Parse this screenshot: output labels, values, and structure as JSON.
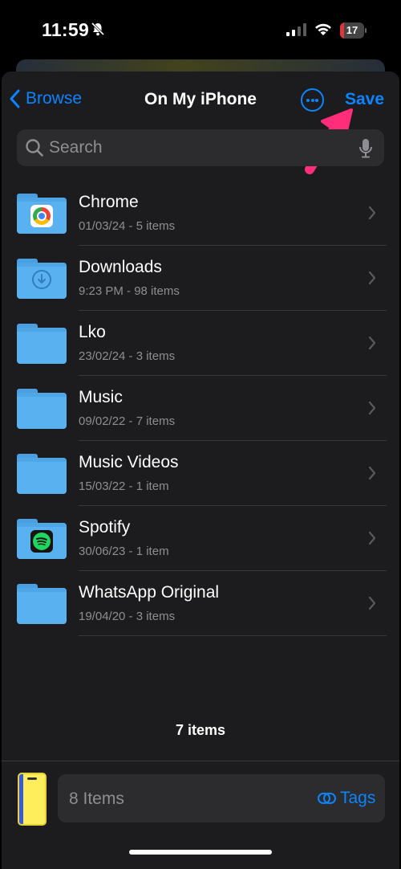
{
  "status": {
    "time": "11:59",
    "battery": "17",
    "battery_level": 0.17
  },
  "nav": {
    "back_label": "Browse",
    "title": "On My iPhone",
    "save_label": "Save"
  },
  "search": {
    "placeholder": "Search"
  },
  "folders": [
    {
      "name": "Chrome",
      "meta": "01/03/24 - 5 items",
      "badge": "chrome-icon"
    },
    {
      "name": "Downloads",
      "meta": "9:23 PM - 98 items",
      "badge": "download-icon"
    },
    {
      "name": "Lko",
      "meta": "23/02/24 - 3 items",
      "badge": ""
    },
    {
      "name": "Music",
      "meta": "09/02/22 - 7 items",
      "badge": ""
    },
    {
      "name": "Music Videos",
      "meta": "15/03/22 - 1 item",
      "badge": ""
    },
    {
      "name": "Spotify",
      "meta": "30/06/23 - 1 item",
      "badge": "spotify-icon"
    },
    {
      "name": "WhatsApp Original",
      "meta": "19/04/20 - 3 items",
      "badge": ""
    }
  ],
  "footer": {
    "count": "7 items",
    "field_label": "8 Items",
    "tags_label": "Tags"
  },
  "colors": {
    "accent": "#0a84ff",
    "annotation_arrow": "#ff2d7a",
    "folder": "#5ab1ef"
  }
}
